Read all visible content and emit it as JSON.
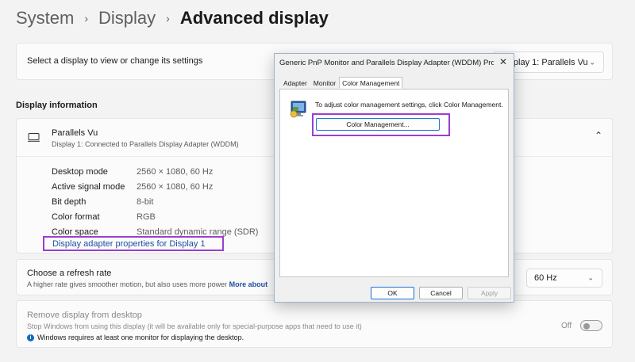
{
  "breadcrumb": {
    "items": [
      "System",
      "Display"
    ],
    "current": "Advanced display",
    "separator": "›"
  },
  "select_display": {
    "label": "Select a display to view or change its settings",
    "value": "Display 1: Parallels Vu"
  },
  "display_info": {
    "title": "Display information",
    "monitor_name": "Parallels Vu",
    "monitor_desc": "Display 1: Connected to Parallels Display Adapter (WDDM)",
    "properties": [
      {
        "key": "Desktop mode",
        "value": "2560 × 1080, 60 Hz"
      },
      {
        "key": "Active signal mode",
        "value": "2560 × 1080, 60 Hz"
      },
      {
        "key": "Bit depth",
        "value": "8-bit"
      },
      {
        "key": "Color format",
        "value": "RGB"
      },
      {
        "key": "Color space",
        "value": "Standard dynamic range (SDR)"
      }
    ],
    "adapter_link": "Display adapter properties for Display 1"
  },
  "refresh": {
    "title": "Choose a refresh rate",
    "subtitle": "A higher rate gives smoother motion, but also uses more power",
    "more": "More about",
    "value": "60 Hz"
  },
  "remove": {
    "title": "Remove display from desktop",
    "subtitle": "Stop Windows from using this display (it will be available only for special-purpose apps that need to use it)",
    "note": "Windows requires at least one monitor for displaying the desktop.",
    "toggle_label": "Off",
    "toggle_on": false
  },
  "dialog": {
    "title": "Generic PnP Monitor and Parallels Display Adapter (WDDM) Prope...",
    "close": "✕",
    "tabs": [
      "Adapter",
      "Monitor",
      "Color Management"
    ],
    "active_tab": "Color Management",
    "instruction": "To adjust color management settings, click Color Management.",
    "cm_button": "Color Management...",
    "ok": "OK",
    "cancel": "Cancel",
    "apply": "Apply"
  },
  "colors": {
    "highlight": "#9b3fd1",
    "link": "#1f4ea3",
    "accent": "#0f6cbd"
  }
}
